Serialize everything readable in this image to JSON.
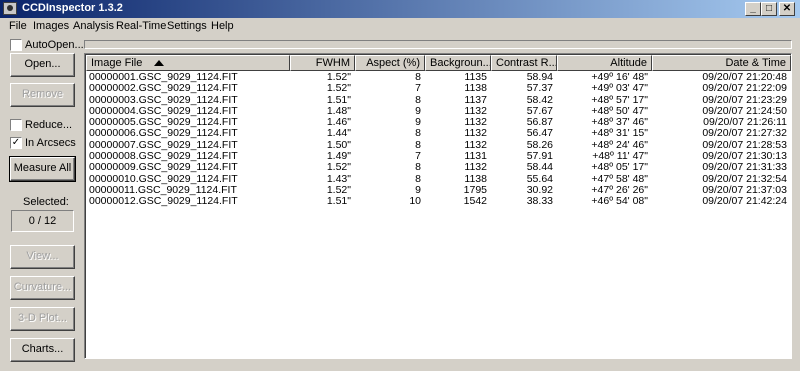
{
  "window": {
    "title": "CCDInspector 1.3.2",
    "controls": {
      "minimize": "_",
      "maximize": "□",
      "close": "✕"
    }
  },
  "menu": [
    "File",
    "Images",
    "Analysis",
    "Real-Time",
    "Settings",
    "Help"
  ],
  "autoopen": {
    "label": "AutoOpen...",
    "checked": false
  },
  "sidebar": {
    "open_label": "Open...",
    "remove_label": "Remove",
    "reduce_label": "Reduce...",
    "arcsecs_label": "In Arcsecs",
    "arcsecs_check": "✓",
    "measure_label": "Measure All",
    "selected_label": "Selected:",
    "selected_value": "0 / 12",
    "view_label": "View...",
    "curvature_label": "Curvature...",
    "plot3d_label": "3-D Plot...",
    "charts_label": "Charts..."
  },
  "table": {
    "columns": [
      "Image File",
      "FWHM",
      "Aspect (%)",
      "Backgroun...",
      "Contrast R...",
      "Altitude",
      "Date & Time"
    ],
    "sort_column": "Image File",
    "rows": [
      [
        "00000001.GSC_9029_1124.FIT",
        "1.52\"",
        "8",
        "1135",
        "58.94",
        "+49º 16' 48\"",
        "09/20/07 21:20:48"
      ],
      [
        "00000002.GSC_9029_1124.FIT",
        "1.52\"",
        "7",
        "1138",
        "57.37",
        "+49º 03' 47\"",
        "09/20/07 21:22:09"
      ],
      [
        "00000003.GSC_9029_1124.FIT",
        "1.51\"",
        "8",
        "1137",
        "58.42",
        "+48º 57' 17\"",
        "09/20/07 21:23:29"
      ],
      [
        "00000004.GSC_9029_1124.FIT",
        "1.48\"",
        "9",
        "1132",
        "57.67",
        "+48º 50' 47\"",
        "09/20/07 21:24:50"
      ],
      [
        "00000005.GSC_9029_1124.FIT",
        "1.46\"",
        "9",
        "1132",
        "56.87",
        "+48º 37' 46\"",
        "09/20/07 21:26:11"
      ],
      [
        "00000006.GSC_9029_1124.FIT",
        "1.44\"",
        "8",
        "1132",
        "56.47",
        "+48º 31' 15\"",
        "09/20/07 21:27:32"
      ],
      [
        "00000007.GSC_9029_1124.FIT",
        "1.50\"",
        "8",
        "1132",
        "58.26",
        "+48º 24' 46\"",
        "09/20/07 21:28:53"
      ],
      [
        "00000008.GSC_9029_1124.FIT",
        "1.49\"",
        "7",
        "1131",
        "57.91",
        "+48º 11' 47\"",
        "09/20/07 21:30:13"
      ],
      [
        "00000009.GSC_9029_1124.FIT",
        "1.52\"",
        "8",
        "1132",
        "58.44",
        "+48º 05' 17\"",
        "09/20/07 21:31:33"
      ],
      [
        "00000010.GSC_9029_1124.FIT",
        "1.43\"",
        "8",
        "1138",
        "55.64",
        "+47º 58' 48\"",
        "09/20/07 21:32:54"
      ],
      [
        "00000011.GSC_9029_1124.FIT",
        "1.52\"",
        "9",
        "1795",
        "30.92",
        "+47º 26' 26\"",
        "09/20/07 21:37:03"
      ],
      [
        "00000012.GSC_9029_1124.FIT",
        "1.51\"",
        "10",
        "1542",
        "38.33",
        "+46º 54' 08\"",
        "09/20/07 21:42:24"
      ]
    ]
  }
}
